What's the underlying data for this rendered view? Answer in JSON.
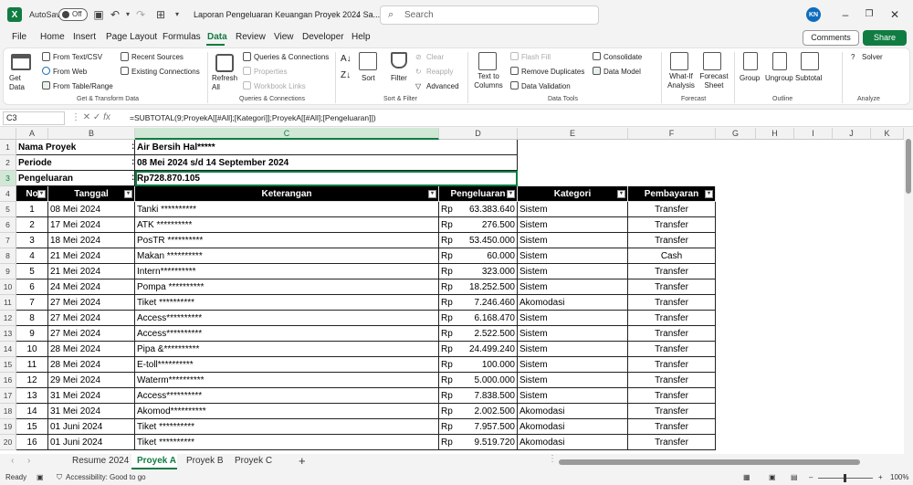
{
  "titlebar": {
    "autosave_label": "AutoSave",
    "autosave_state": "Off",
    "doc_title": "Laporan Pengeluaran Keuangan Proyek 2024 Sa...",
    "search_placeholder": "Search",
    "avatar_initials": "KN"
  },
  "menu": [
    "File",
    "Home",
    "Insert",
    "Page Layout",
    "Formulas",
    "Data",
    "Review",
    "View",
    "Developer",
    "Help"
  ],
  "menu_active": "Data",
  "comments_label": "Comments",
  "share_label": "Share",
  "ribbon": {
    "get_data": "Get Data",
    "from_text_csv": "From Text/CSV",
    "from_web": "From Web",
    "from_table_range": "From Table/Range",
    "recent_sources": "Recent Sources",
    "existing_connections": "Existing Connections",
    "group_get": "Get & Transform Data",
    "refresh_all": "Refresh All",
    "queries_connections": "Queries & Connections",
    "properties": "Properties",
    "workbook_links": "Workbook Links",
    "group_queries": "Queries & Connections",
    "sort": "Sort",
    "filter": "Filter",
    "clear": "Clear",
    "reapply": "Reapply",
    "advanced": "Advanced",
    "group_sort": "Sort & Filter",
    "text_to_columns": "Text to Columns",
    "flash_fill": "Flash Fill",
    "remove_duplicates": "Remove Duplicates",
    "data_validation": "Data Validation",
    "consolidate": "Consolidate",
    "data_model": "Data Model",
    "group_tools": "Data Tools",
    "what_if": "What-If Analysis",
    "forecast_sheet": "Forecast Sheet",
    "group_forecast": "Forecast",
    "group_btn": "Group",
    "ungroup": "Ungroup",
    "subtotal": "Subtotal",
    "group_outline": "Outline",
    "solver": "Solver",
    "group_analyze": "Analyze"
  },
  "formula_bar": {
    "name_box": "C3",
    "formula": "=SUBTOTAL(9;ProyekA[[#All];[Kategori]];ProyekA[[#All];[Pengeluaran]])"
  },
  "columns": [
    "A",
    "B",
    "C",
    "D",
    "E",
    "F",
    "G",
    "H",
    "I",
    "J",
    "K"
  ],
  "row_numbers": [
    "1",
    "2",
    "3",
    "4",
    "5",
    "6",
    "7",
    "8",
    "9",
    "10",
    "11",
    "12",
    "13",
    "14",
    "15",
    "16",
    "17",
    "18",
    "19",
    "20"
  ],
  "info": [
    {
      "label": "Nama Proyek",
      "colon": ":",
      "value": "Air Bersih Hal*****"
    },
    {
      "label": "Periode",
      "colon": ":",
      "value": "08 Mei 2024 s/d 14 September 2024"
    },
    {
      "label": "Pengeluaran",
      "colon": ":",
      "value": "Rp728.870.105"
    }
  ],
  "table_headers": [
    "No",
    "Tanggal",
    "Keterangan",
    "Pengeluaran",
    "Kategori",
    "Pembayaran"
  ],
  "currency": "Rp",
  "rows": [
    [
      "1",
      "08 Mei 2024",
      "Tanki **********",
      "63.383.640",
      "Sistem",
      "Transfer"
    ],
    [
      "2",
      "17 Mei 2024",
      "ATK **********",
      "276.500",
      "Sistem",
      "Transfer"
    ],
    [
      "3",
      "18 Mei 2024",
      "PosTR **********",
      "53.450.000",
      "Sistem",
      "Transfer"
    ],
    [
      "4",
      "21 Mei 2024",
      "Makan **********",
      "60.000",
      "Sistem",
      "Cash"
    ],
    [
      "5",
      "21 Mei 2024",
      "Intern**********",
      "323.000",
      "Sistem",
      "Transfer"
    ],
    [
      "6",
      "24 Mei 2024",
      "Pompa **********",
      "18.252.500",
      "Sistem",
      "Transfer"
    ],
    [
      "7",
      "27 Mei 2024",
      "Tiket **********",
      "7.246.460",
      "Akomodasi",
      "Transfer"
    ],
    [
      "8",
      "27 Mei 2024",
      "Access**********",
      "6.168.470",
      "Sistem",
      "Transfer"
    ],
    [
      "9",
      "27 Mei 2024",
      "Access**********",
      "2.522.500",
      "Sistem",
      "Transfer"
    ],
    [
      "10",
      "28 Mei 2024",
      "Pipa &**********",
      "24.499.240",
      "Sistem",
      "Transfer"
    ],
    [
      "11",
      "28 Mei 2024",
      "E-toll**********",
      "100.000",
      "Sistem",
      "Transfer"
    ],
    [
      "12",
      "29 Mei 2024",
      "Waterm**********",
      "5.000.000",
      "Sistem",
      "Transfer"
    ],
    [
      "13",
      "31 Mei 2024",
      "Access**********",
      "7.838.500",
      "Sistem",
      "Transfer"
    ],
    [
      "14",
      "31 Mei 2024",
      "Akomod**********",
      "2.002.500",
      "Akomodasi",
      "Transfer"
    ],
    [
      "15",
      "01 Juni 2024",
      "Tiket **********",
      "7.957.500",
      "Akomodasi",
      "Transfer"
    ],
    [
      "16",
      "01 Juni 2024",
      "Tiket **********",
      "9.519.720",
      "Akomodasi",
      "Transfer"
    ]
  ],
  "sheets": [
    "Resume 2024",
    "Proyek A",
    "Proyek B",
    "Proyek C"
  ],
  "active_sheet": "Proyek A",
  "status": {
    "ready": "Ready",
    "accessibility": "Accessibility: Good to go",
    "zoom": "100%"
  }
}
